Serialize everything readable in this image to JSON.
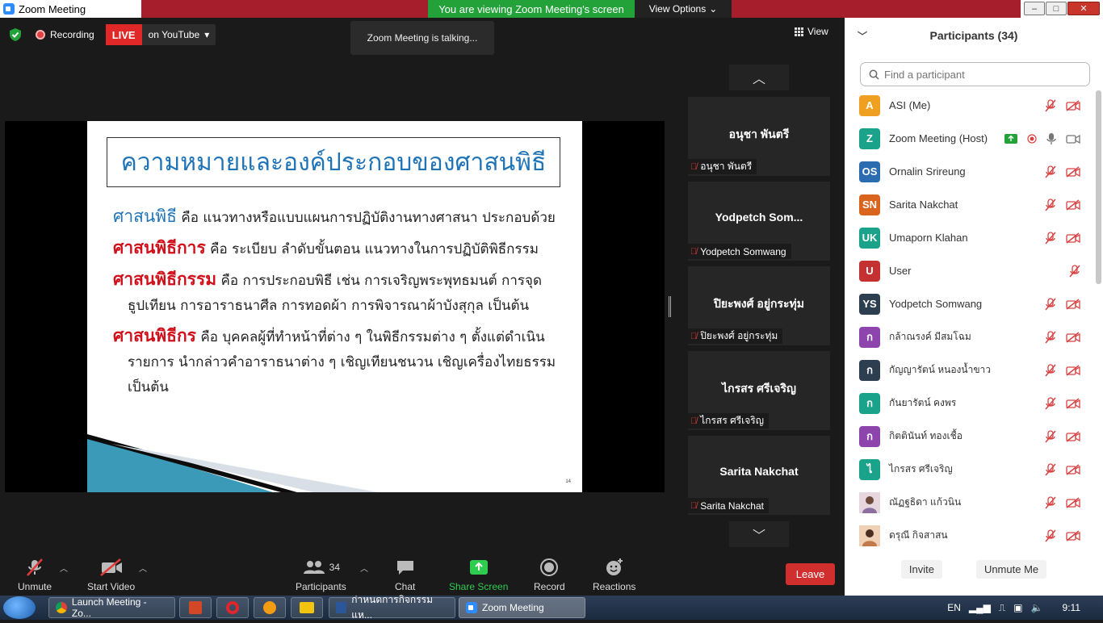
{
  "window": {
    "title": "Zoom Meeting",
    "viewing_banner": "You are viewing Zoom Meeting's screen",
    "view_options": "View Options",
    "minimize": "–",
    "maximize": "□",
    "close": "✕"
  },
  "meeting": {
    "recording_label": "Recording",
    "live_label": "LIVE",
    "live_target": "on YouTube",
    "talking": "Zoom Meeting is talking...",
    "view_label": "View"
  },
  "slide": {
    "title": "ความหมายและองค์ประกอบของศาสนพิธี",
    "p1_term": "ศาสนพิธี",
    "p1_text": "คือ แนวทางหรือแบบแผนการปฏิบัติงานทางศาสนา ประกอบด้วย",
    "p2_term": "ศาสนพิธีการ",
    "p2_text": "คือ ระเบียบ ลำดับขั้นตอน  แนวทางในการปฏิบัติพิธีกรรม",
    "p3_term": "ศาสนพิธีกรรม",
    "p3_text": "คือ การประกอบพิธี เช่น การเจริญพระพุทธมนต์ การจุด",
    "p3_cont": "ธูปเทียน  การอาราธนาศีล การทอดผ้า  การพิจารณาผ้าบังสุกุล เป็นต้น",
    "p4_term": "ศาสนพิธีกร",
    "p4_text": "คือ บุคคลผู้ที่ทำหน้าที่ต่าง ๆ ในพิธีกรรมต่าง ๆ ตั้งแต่ดำเนิน",
    "p4_cont1": "รายการ นำกล่าวคำอาราธนาต่าง ๆ เชิญเทียนชนวน เชิญเครื่องไทยธรรม",
    "p4_cont2": "เป็นต้น",
    "page_num": "14"
  },
  "gallery": {
    "tiles": [
      {
        "name": "อนุชา พันตรี",
        "label": "อนุชา พันตรี"
      },
      {
        "name": "Yodpetch   Som...",
        "label": "Yodpetch  Somwang"
      },
      {
        "name": "ปิยะพงศ์ อยู่กระทุ่ม",
        "label": "ปิยะพงศ์ อยู่กระทุ่ม"
      },
      {
        "name": "ไกรสร ศรีเจริญ",
        "label": "ไกรสร ศรีเจริญ"
      },
      {
        "name": "Sarita Nakchat",
        "label": "Sarita Nakchat"
      }
    ]
  },
  "toolbar": {
    "unmute": "Unmute",
    "start_video": "Start Video",
    "participants": "Participants",
    "participants_count": "34",
    "chat": "Chat",
    "share_screen": "Share Screen",
    "record": "Record",
    "reactions": "Reactions",
    "leave": "Leave"
  },
  "panel": {
    "title": "Participants (34)",
    "search_placeholder": "Find a participant",
    "invite": "Invite",
    "unmute_me": "Unmute Me",
    "participants": [
      {
        "initials": "A",
        "name": "ASI (Me)",
        "color": "#f0a020"
      },
      {
        "initials": "Z",
        "name": "Zoom Meeting (Host)",
        "color": "#1aa38a"
      },
      {
        "initials": "OS",
        "name": "Ornalin Srireung",
        "color": "#2b6cb0"
      },
      {
        "initials": "SN",
        "name": "Sarita Nakchat",
        "color": "#d9641e"
      },
      {
        "initials": "UK",
        "name": "Umaporn Klahan",
        "color": "#1aa38a"
      },
      {
        "initials": "U",
        "name": "User",
        "color": "#c53030"
      },
      {
        "initials": "YS",
        "name": "Yodpetch  Somwang",
        "color": "#2d3e50"
      },
      {
        "initials": "ก",
        "name": "กล้าณรงค์ มีสมโฉม",
        "color": "#8e44ad"
      },
      {
        "initials": "ก",
        "name": "กัญญารัตน์ หนองน้ำขาว",
        "color": "#2d3e50"
      },
      {
        "initials": "ก",
        "name": "กันยารัตน์ คงพร",
        "color": "#1aa38a"
      },
      {
        "initials": "ก",
        "name": "กิตตินันท์ ทองเชื้อ",
        "color": "#8e44ad"
      },
      {
        "initials": "ไ",
        "name": "ไกรสร ศรีเจริญ",
        "color": "#1aa38a"
      },
      {
        "initials": "",
        "name": "ณัฏฐธิดา แก้วนิน",
        "color": "#c9a1b5"
      },
      {
        "initials": "",
        "name": "ดรุณี กิจสาสน",
        "color": "#d49a6a"
      }
    ]
  },
  "taskbar": {
    "tasks": [
      "Launch Meeting - Zo...",
      "",
      "",
      "",
      "",
      "ก่าหนดการกิจกรรมแห...",
      "Zoom Meeting"
    ],
    "lang": "EN",
    "time": "9:11"
  }
}
